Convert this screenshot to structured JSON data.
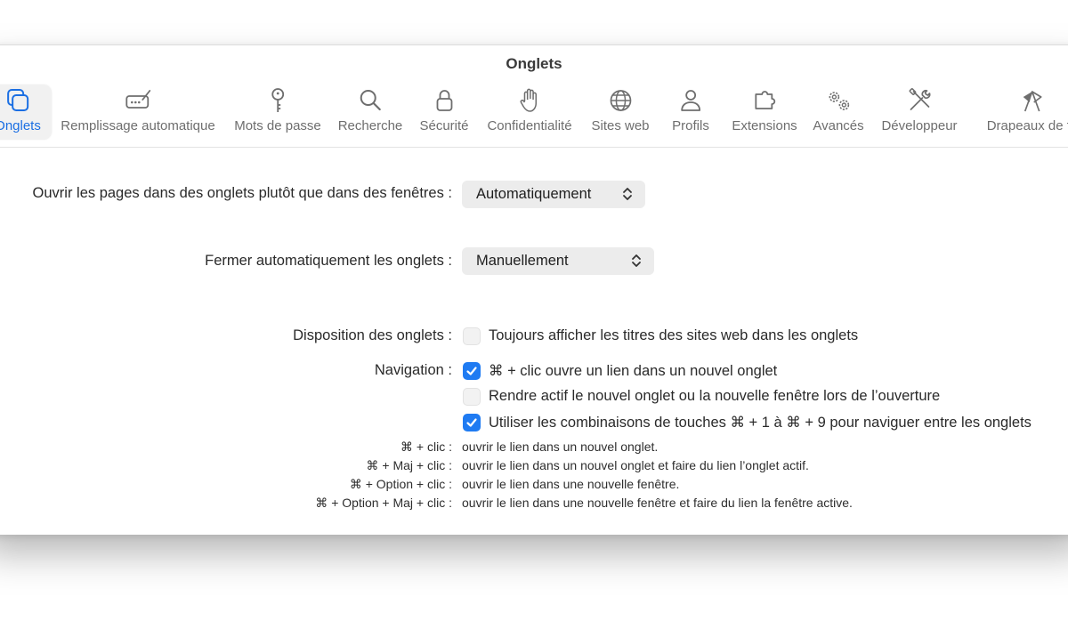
{
  "window": {
    "title": "Onglets"
  },
  "toolbar": {
    "items": [
      {
        "label": "Onglets",
        "icon": "tabs-icon",
        "active": true
      },
      {
        "label": "Remplissage automatique",
        "icon": "autofill-icon"
      },
      {
        "label": "Mots de passe",
        "icon": "key-icon"
      },
      {
        "label": "Recherche",
        "icon": "search-icon"
      },
      {
        "label": "Sécurité",
        "icon": "lock-icon"
      },
      {
        "label": "Confidentialité",
        "icon": "hand-icon"
      },
      {
        "label": "Sites web",
        "icon": "globe-icon"
      },
      {
        "label": "Profils",
        "icon": "person-icon"
      },
      {
        "label": "Extensions",
        "icon": "puzzle-icon"
      },
      {
        "label": "Avancés",
        "icon": "gears-icon"
      },
      {
        "label": "Développeur",
        "icon": "tools-icon"
      },
      {
        "label": "Drapeaux de fo",
        "icon": "flags-icon"
      }
    ]
  },
  "settings": {
    "open_pages": {
      "label": "Ouvrir les pages dans des onglets plutôt que dans des fenêtres :",
      "value": "Automatiquement"
    },
    "auto_close": {
      "label": "Fermer automatiquement les onglets :",
      "value": "Manuellement"
    },
    "layout": {
      "label": "Disposition des onglets :",
      "option": "Toujours afficher les titres des sites web dans les onglets",
      "checked": false
    },
    "navigation": {
      "label": "Navigation :",
      "options": [
        {
          "text": "⌘ + clic ouvre un lien dans un nouvel onglet",
          "checked": true
        },
        {
          "text": "Rendre actif le nouvel onglet ou la nouvelle fenêtre lors de l’ouverture",
          "checked": false
        },
        {
          "text": "Utiliser les combinaisons de touches ⌘ + 1 à ⌘ + 9 pour naviguer entre les onglets",
          "checked": true
        }
      ]
    },
    "shortcuts": [
      {
        "keys": "⌘ + clic :",
        "desc": "ouvrir le lien dans un nouvel onglet."
      },
      {
        "keys": "⌘ + Maj + clic :",
        "desc": "ouvrir le lien dans un nouvel onglet et faire du lien l’onglet actif."
      },
      {
        "keys": "⌘ + Option + clic :",
        "desc": "ouvrir le lien dans une nouvelle fenêtre."
      },
      {
        "keys": "⌘ + Option + Maj + clic :",
        "desc": "ouvrir le lien dans une nouvelle fenêtre et faire du lien la fenêtre active."
      }
    ]
  },
  "colors": {
    "accent": "#1f7bf2",
    "active_label": "#1b6fe3",
    "icon": "#6e6e6e"
  }
}
